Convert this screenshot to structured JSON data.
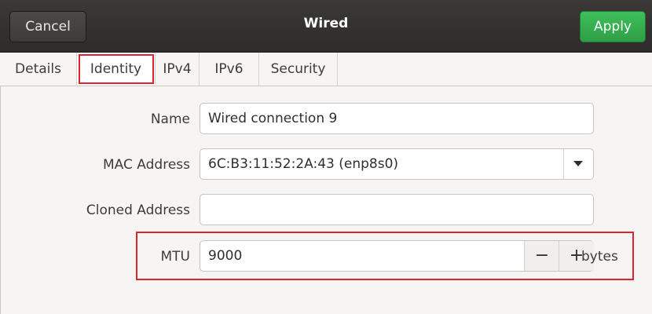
{
  "header": {
    "title": "Wired",
    "cancel_label": "Cancel",
    "apply_label": "Apply"
  },
  "tabs": [
    {
      "label": "Details",
      "active": false
    },
    {
      "label": "Identity",
      "active": true
    },
    {
      "label": "IPv4",
      "active": false
    },
    {
      "label": "IPv6",
      "active": false
    },
    {
      "label": "Security",
      "active": false
    }
  ],
  "identity": {
    "name": {
      "label": "Name",
      "value": "Wired connection 9"
    },
    "mac": {
      "label": "MAC Address",
      "value": "6C:B3:11:52:2A:43 (enp8s0)"
    },
    "cloned": {
      "label": "Cloned Address",
      "value": ""
    },
    "mtu": {
      "label": "MTU",
      "value": "9000",
      "minus": "−",
      "plus": "+",
      "unit": "bytes"
    }
  },
  "colors": {
    "apply_green": "#3fbf5a",
    "highlight_red": "#e0242e",
    "headerbar": "#333231"
  },
  "icons": {
    "dropdown": "chevron-down-icon"
  }
}
